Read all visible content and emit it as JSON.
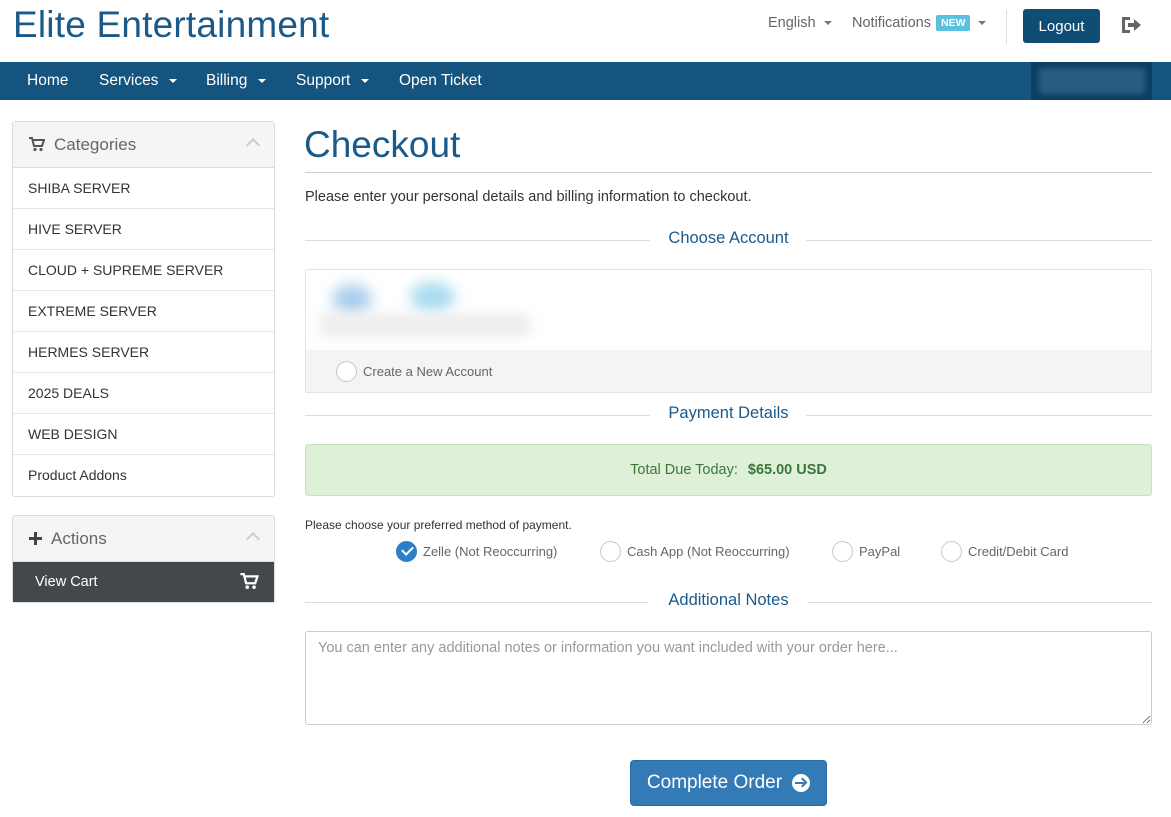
{
  "header": {
    "brand": "Elite Entertainment",
    "language": "English",
    "notifications": "Notifications",
    "notifications_badge": "NEW",
    "logout": "Logout",
    "exit_icon": "sign-out-icon"
  },
  "nav": {
    "items": [
      {
        "label": "Home"
      },
      {
        "label": "Services"
      },
      {
        "label": "Billing"
      },
      {
        "label": "Support"
      },
      {
        "label": "Open Ticket"
      }
    ]
  },
  "sidebar": {
    "categories_title": "Categories",
    "categories_icon": "shopping-cart-icon",
    "categories": [
      {
        "label": "SHIBA SERVER"
      },
      {
        "label": "HIVE SERVER"
      },
      {
        "label": "CLOUD + SUPREME SERVER"
      },
      {
        "label": "EXTREME SERVER"
      },
      {
        "label": "HERMES SERVER"
      },
      {
        "label": "2025 DEALS"
      },
      {
        "label": "WEB DESIGN"
      },
      {
        "label": "Product Addons"
      }
    ],
    "actions_title": "Actions",
    "actions_icon": "plus-icon",
    "view_cart": "View Cart"
  },
  "main": {
    "title": "Checkout",
    "intro": "Please enter your personal details and billing information to checkout.",
    "choose_account": "Choose Account",
    "create_account": "Create a New Account",
    "payment_details": "Payment Details",
    "total_label": "Total Due Today:",
    "total_amount": "$65.00 USD",
    "payment_prompt": "Please choose your preferred method of payment.",
    "payment_methods": [
      {
        "label": "Zelle (Not Reoccurring)",
        "selected": true
      },
      {
        "label": "Cash App (Not Reoccurring)",
        "selected": false
      },
      {
        "label": "PayPal",
        "selected": false
      },
      {
        "label": "Credit/Debit Card",
        "selected": false
      }
    ],
    "additional_notes": "Additional Notes",
    "notes_placeholder": "You can enter any additional notes or information you want included with your order here...",
    "complete_order": "Complete Order"
  },
  "colors": {
    "brand": "#1a5a8a",
    "nav_bg": "#14547f",
    "primary_button": "#337ab7",
    "success_bg": "#dff0d8"
  }
}
